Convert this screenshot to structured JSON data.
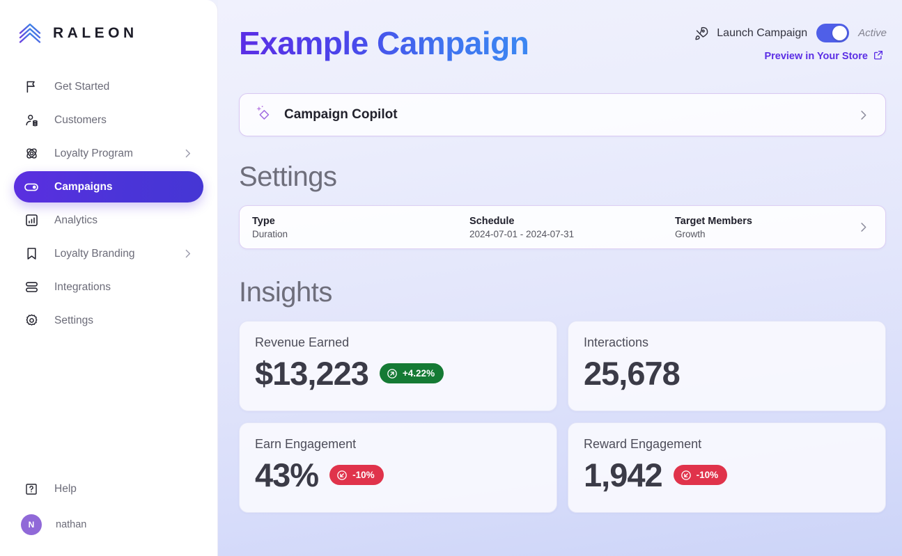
{
  "brand": {
    "name": "RALEON",
    "logo_icon": "chevron-logo-icon",
    "logo_gradient_from": "#6b3fe0",
    "logo_gradient_to": "#2f9ae8"
  },
  "sidebar": {
    "items": [
      {
        "label": "Get Started",
        "icon": "flag-icon",
        "active": false,
        "expandable": false
      },
      {
        "label": "Customers",
        "icon": "customers-icon",
        "active": false,
        "expandable": false
      },
      {
        "label": "Loyalty Program",
        "icon": "atom-icon",
        "active": false,
        "expandable": true
      },
      {
        "label": "Campaigns",
        "icon": "toggle-icon",
        "active": true,
        "expandable": false
      },
      {
        "label": "Analytics",
        "icon": "bar-chart-icon",
        "active": false,
        "expandable": false
      },
      {
        "label": "Loyalty Branding",
        "icon": "bookmark-icon",
        "active": false,
        "expandable": true
      },
      {
        "label": "Integrations",
        "icon": "stack-icon",
        "active": false,
        "expandable": false
      },
      {
        "label": "Settings",
        "icon": "gear-icon",
        "active": false,
        "expandable": false
      }
    ],
    "help": {
      "label": "Help",
      "icon": "help-square-icon"
    },
    "user": {
      "name": "nathan",
      "initial": "N",
      "avatar_color": "#9069d8"
    },
    "active_color": "#5530de"
  },
  "header": {
    "title": "Example Campaign",
    "title_gradient_from": "#5b2ee5",
    "title_gradient_to": "#3c87f2",
    "launch_label": "Launch Campaign",
    "launch_icon": "rocket-icon",
    "toggle_state_label": "Active",
    "toggle_on": true,
    "toggle_color": "#4f5fe8",
    "preview_label": "Preview in Your Store",
    "preview_icon": "external-link-icon",
    "preview_color": "#5b2ee5"
  },
  "copilot": {
    "title": "Campaign Copilot",
    "icon": "sparkle-diamond-icon",
    "chevron": "chevron-right-icon",
    "accent_color": "#a06be0"
  },
  "settings": {
    "heading": "Settings",
    "fields": [
      {
        "label": "Type",
        "value": "Duration"
      },
      {
        "label": "Schedule",
        "value": "2024-07-01 - 2024-07-31"
      },
      {
        "label": "Target Members",
        "value": "Growth"
      }
    ],
    "chevron": "chevron-right-icon"
  },
  "insights": {
    "heading": "Insights",
    "metrics": [
      {
        "label": "Revenue Earned",
        "value": "$13,223",
        "badge": {
          "text": "+4.22%",
          "direction": "up",
          "icon": "arrow-up-right-circle-icon",
          "color": "#157a34"
        }
      },
      {
        "label": "Interactions",
        "value": "25,678",
        "badge": null
      },
      {
        "label": "Earn Engagement",
        "value": "43%",
        "badge": {
          "text": "-10%",
          "direction": "down",
          "icon": "arrow-down-left-circle-icon",
          "color": "#e0334b"
        }
      },
      {
        "label": "Reward Engagement",
        "value": "1,942",
        "badge": {
          "text": "-10%",
          "direction": "down",
          "icon": "arrow-down-left-circle-icon",
          "color": "#e0334b"
        }
      }
    ]
  }
}
